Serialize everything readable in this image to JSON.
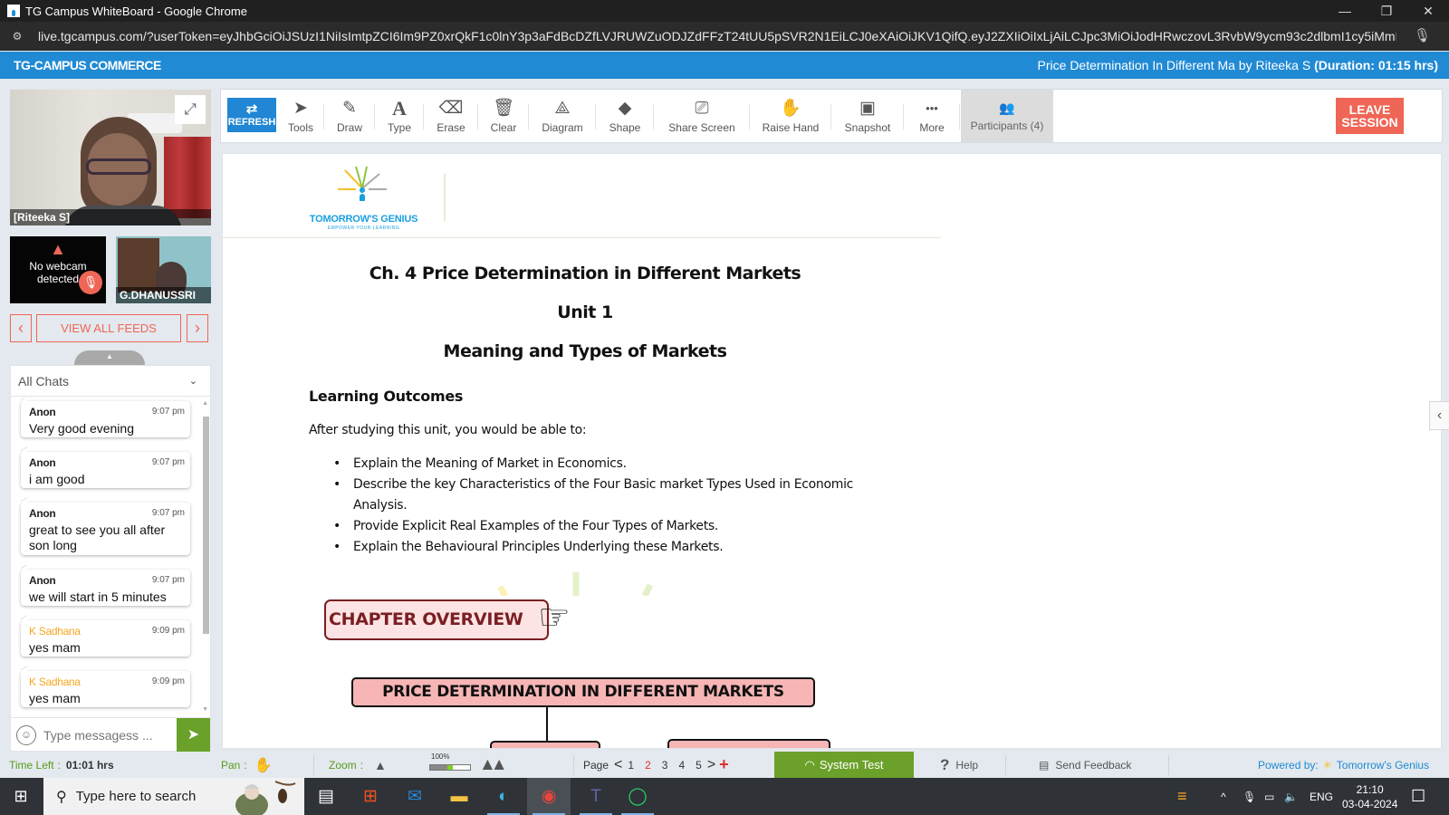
{
  "browser": {
    "window_title": "TG Campus WhiteBoard - Google Chrome",
    "url": "live.tgcampus.com/?userToken=eyJhbGciOiJSUzI1NiIsImtpZCI6Im9PZ0xrQkF1c0lnY3p3aFdBcDZfLVJRUWZuODJZdFFzT24tUU5pSVR2N1EiLCJ0eXAiOiJKV1QifQ.eyJ2ZXIiOiIxLjAiLCJpc3MiOiJodHRwczovL3RvbW9ycm93c2dlbmI1cy5iMmNsb2dpbi5jb...",
    "minimize": "—",
    "restore": "❐",
    "close": "✕"
  },
  "app": {
    "brand": "TG-CAMPUS COMMERCE",
    "session_title": "Price Determination In Different Ma by Riteeka S ",
    "duration_label": "(Duration: 01:15 hrs)"
  },
  "toolbar": {
    "refresh": "REFRESH",
    "tools": [
      {
        "label": "Tools",
        "icon": "cursor-icon",
        "glyph": "➤"
      },
      {
        "label": "Draw",
        "icon": "pencil-icon",
        "glyph": "✎"
      },
      {
        "label": "Type",
        "icon": "text-icon",
        "glyph": "A"
      },
      {
        "label": "Erase",
        "icon": "eraser-icon",
        "glyph": "⌫"
      },
      {
        "label": "Clear",
        "icon": "trash-icon",
        "glyph": "🗑"
      },
      {
        "label": "Diagram",
        "icon": "compass-icon",
        "glyph": "⟁"
      },
      {
        "label": "Shape",
        "icon": "shapes-icon",
        "glyph": "◆"
      },
      {
        "label": "Share Screen",
        "icon": "share-screen-icon",
        "glyph": "⎚"
      },
      {
        "label": "Raise Hand",
        "icon": "hand-icon",
        "glyph": "✋"
      },
      {
        "label": "Snapshot",
        "icon": "image-icon",
        "glyph": "▣"
      },
      {
        "label": "More",
        "icon": "more-icon",
        "glyph": "•••"
      }
    ],
    "participants": "Participants (4)",
    "leave_line1": "LEAVE",
    "leave_line2": "SESSION"
  },
  "feeds": {
    "main_name": "[Riteeka S]",
    "no_webcam": "No webcam detected",
    "second_name": "G.DHANUSSRI",
    "view_all": "VIEW ALL FEEDS"
  },
  "chat": {
    "filter": "All Chats",
    "messages": [
      {
        "author": "Anon",
        "time": "9:07 pm",
        "text": "Very good evening",
        "highlight": false
      },
      {
        "author": "Anon",
        "time": "9:07 pm",
        "text": "i am good",
        "highlight": false
      },
      {
        "author": "Anon",
        "time": "9:07 pm",
        "text": "great to see you all after son long",
        "highlight": false
      },
      {
        "author": "Anon",
        "time": "9:07 pm",
        "text": "we will start in 5 minutes",
        "highlight": false
      },
      {
        "author": "K Sadhana",
        "time": "9:09 pm",
        "text": "yes mam",
        "highlight": true
      },
      {
        "author": "K Sadhana",
        "time": "9:09 pm",
        "text": "yes mam",
        "highlight": true
      }
    ],
    "input_placeholder": "Type messagess ...",
    "author_highlight_color": "#f5a623"
  },
  "document": {
    "logo_word": "TOMORROW'S GENIUS",
    "logo_tag": "EMPOWER YOUR LEARNING",
    "chapter_title": "Ch. 4 Price Determination in Different Markets",
    "unit": "Unit 1",
    "unit_title": "Meaning and Types of Markets",
    "outcomes_title": "Learning Outcomes",
    "outcomes_intro": "After studying this unit, you would be able to:",
    "outcomes": [
      "Explain the Meaning of Market in Economics.",
      "Describe the key Characteristics of the Four Basic market Types Used in Economic Analysis.",
      "Provide Explicit Real Examples of the Four Types of Markets.",
      "Explain the Behavioural Principles Underlying these Markets."
    ],
    "overview_label": "CHAPTER OVERVIEW",
    "diagram_root": "PRICE DETERMINATION IN DIFFERENT MARKETS"
  },
  "status": {
    "time_left_label": "Time Left",
    "time_left_value": "01:01 hrs",
    "pan_label": "Pan",
    "zoom_label": "Zoom",
    "zoom_value": "100%",
    "zoom_fraction": 0.5,
    "page_label": "Page",
    "pages": [
      "1",
      "2",
      "3",
      "4",
      "5"
    ],
    "current_page": "2",
    "system_test": "System Test",
    "help": "Help",
    "feedback": "Send Feedback",
    "powered_by": "Powered by:",
    "powered_brand": "Tomorrow's Genius"
  },
  "taskbar": {
    "search_placeholder": "Type here to search",
    "language": "ENG",
    "time": "21:10",
    "date": "03-04-2024"
  }
}
